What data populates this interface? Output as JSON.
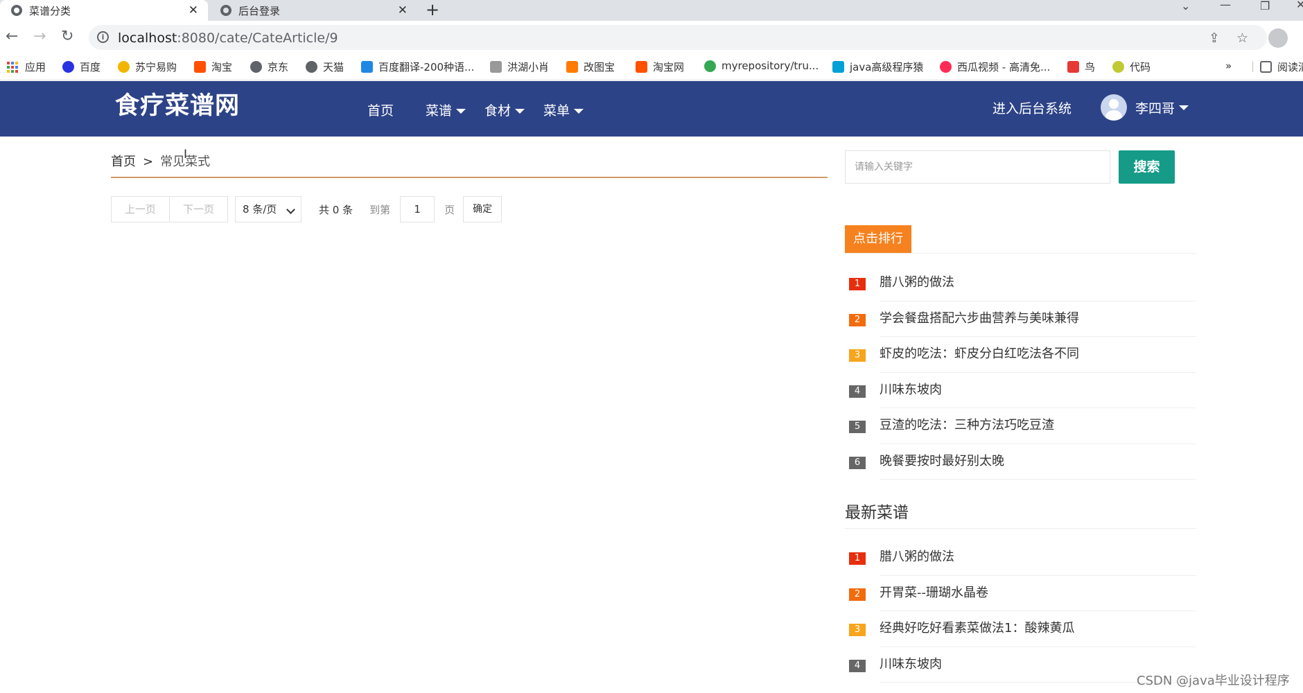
{
  "browser": {
    "tabs": [
      {
        "title": "菜谱分类",
        "active": true
      },
      {
        "title": "后台登录",
        "active": false
      }
    ],
    "url_host": "localhost",
    "url_path": ":8080/cate/CateArticle/9",
    "bookmarks": [
      {
        "label": "应用",
        "color": "#4285f4"
      },
      {
        "label": "百度",
        "color": "#2932e1"
      },
      {
        "label": "苏宁易购",
        "color": "#f2b600"
      },
      {
        "label": "淘宝",
        "color": "#ff5000"
      },
      {
        "label": "京东",
        "color": "#5f6368"
      },
      {
        "label": "天猫",
        "color": "#5f6368"
      },
      {
        "label": "百度翻译-200种语...",
        "color": "#1e88e5"
      },
      {
        "label": "洪湖小肖",
        "color": "#999999"
      },
      {
        "label": "改图宝",
        "color": "#ff7a00"
      },
      {
        "label": "淘宝网",
        "color": "#ff5000"
      },
      {
        "label": "myrepository/tru...",
        "color": "#34a853"
      },
      {
        "label": "java高级程序猿",
        "color": "#00a1d6"
      },
      {
        "label": "西瓜视频 - 高清免...",
        "color": "#fe2c55"
      },
      {
        "label": "鸟",
        "color": "#e53935"
      },
      {
        "label": "代码",
        "color": "#c0ca33"
      }
    ],
    "bookmarks_overflow": "»",
    "reading_list": "阅读清"
  },
  "header": {
    "logo": "食疗菜谱网",
    "nav": [
      {
        "label": "首页",
        "dropdown": false
      },
      {
        "label": "菜谱",
        "dropdown": true
      },
      {
        "label": "食材",
        "dropdown": true
      },
      {
        "label": "菜单",
        "dropdown": true
      }
    ],
    "admin_link": "进入后台系统",
    "username": "李四哥"
  },
  "breadcrumb": {
    "home": "首页",
    "separator": ">",
    "current": "常见菜式"
  },
  "pager": {
    "prev": "上一页",
    "next": "下一页",
    "page_size": "8 条/页",
    "total": "共 0 条",
    "goto": "到第",
    "page_value": "1",
    "page_unit": "页",
    "confirm": "确定"
  },
  "sidebar": {
    "search_placeholder": "请输入关键字",
    "search_button": "搜索",
    "rank_title": "点击排行",
    "rank_items": [
      {
        "num": "1",
        "title": "腊八粥的做法"
      },
      {
        "num": "2",
        "title": "学会餐盘搭配六步曲营养与美味兼得"
      },
      {
        "num": "3",
        "title": "虾皮的吃法：虾皮分白红吃法各不同"
      },
      {
        "num": "4",
        "title": "川味东坡肉"
      },
      {
        "num": "5",
        "title": "豆渣的吃法：三种方法巧吃豆渣"
      },
      {
        "num": "6",
        "title": "晚餐要按时最好别太晚"
      }
    ],
    "latest_title": "最新菜谱",
    "latest_items": [
      {
        "num": "1",
        "title": "腊八粥的做法"
      },
      {
        "num": "2",
        "title": "开胃菜--珊瑚水晶卷"
      },
      {
        "num": "3",
        "title": "经典好吃好看素菜做法1：酸辣黄瓜"
      },
      {
        "num": "4",
        "title": "川味东坡肉"
      }
    ]
  },
  "watermark": "CSDN @java毕业设计程序"
}
